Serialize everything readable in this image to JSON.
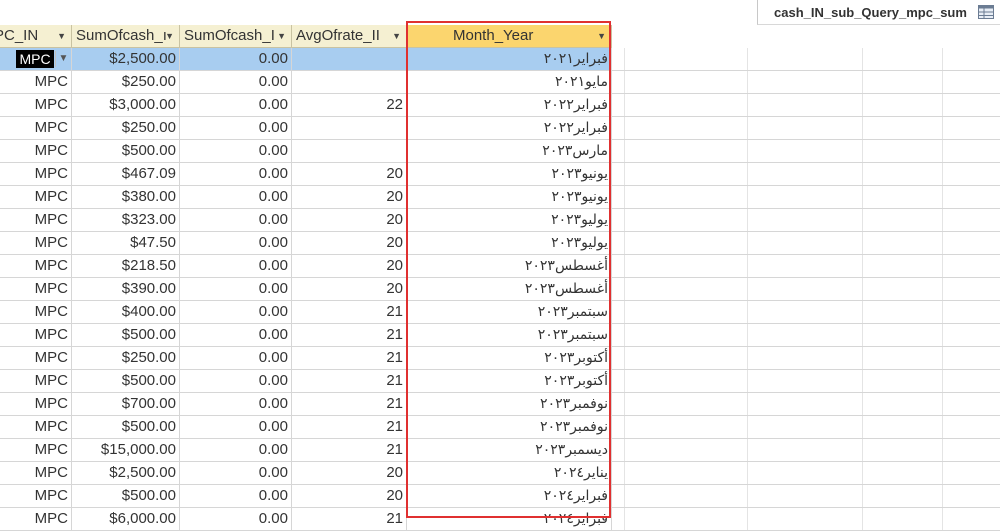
{
  "tab": {
    "title": "cash_IN_sub_Query_mpc_sum",
    "icon": "query-icon"
  },
  "columns": [
    {
      "label": "PC_IN"
    },
    {
      "label": "SumOfcash_ı"
    },
    {
      "label": "SumOfcash_I"
    },
    {
      "label": "AvgOfrate_II"
    },
    {
      "label": "Month_Year"
    }
  ],
  "rows": [
    [
      "MPC",
      "$2,500.00",
      "0.00",
      "",
      "فبراير٢٠٢١"
    ],
    [
      "MPC",
      "$250.00",
      "0.00",
      "",
      "مايو٢٠٢١"
    ],
    [
      "MPC",
      "$3,000.00",
      "0.00",
      "22",
      "فبراير٢٠٢٢"
    ],
    [
      "MPC",
      "$250.00",
      "0.00",
      "",
      "فبراير٢٠٢٢"
    ],
    [
      "MPC",
      "$500.00",
      "0.00",
      "",
      "مارس٢٠٢٣"
    ],
    [
      "MPC",
      "$467.09",
      "0.00",
      "20",
      "يونيو٢٠٢٣"
    ],
    [
      "MPC",
      "$380.00",
      "0.00",
      "20",
      "يونيو٢٠٢٣"
    ],
    [
      "MPC",
      "$323.00",
      "0.00",
      "20",
      "يوليو٢٠٢٣"
    ],
    [
      "MPC",
      "$47.50",
      "0.00",
      "20",
      "يوليو٢٠٢٣"
    ],
    [
      "MPC",
      "$218.50",
      "0.00",
      "20",
      "أغسطس٢٠٢٣"
    ],
    [
      "MPC",
      "$390.00",
      "0.00",
      "20",
      "أغسطس٢٠٢٣"
    ],
    [
      "MPC",
      "$400.00",
      "0.00",
      "21",
      "سبتمبر٢٠٢٣"
    ],
    [
      "MPC",
      "$500.00",
      "0.00",
      "21",
      "سبتمبر٢٠٢٣"
    ],
    [
      "MPC",
      "$250.00",
      "0.00",
      "21",
      "أكتوبر٢٠٢٣"
    ],
    [
      "MPC",
      "$500.00",
      "0.00",
      "21",
      "أكتوبر٢٠٢٣"
    ],
    [
      "MPC",
      "$700.00",
      "0.00",
      "21",
      "نوفمبر٢٠٢٣"
    ],
    [
      "MPC",
      "$500.00",
      "0.00",
      "21",
      "نوفمبر٢٠٢٣"
    ],
    [
      "MPC",
      "$15,000.00",
      "0.00",
      "21",
      "ديسمبر٢٠٢٣"
    ],
    [
      "MPC",
      "$2,500.00",
      "0.00",
      "20",
      "يناير٢٠٢٤"
    ],
    [
      "MPC",
      "$500.00",
      "0.00",
      "20",
      "فبراير٢٠٢٤"
    ],
    [
      "MPC",
      "$6,000.00",
      "0.00",
      "21",
      "فبراير٢٠٢٤"
    ]
  ],
  "colors": {
    "header": "#f5f0d2",
    "active_header": "#fbd56e",
    "selected_row": "#a8cdf0",
    "highlight_frame": "#e03030"
  }
}
